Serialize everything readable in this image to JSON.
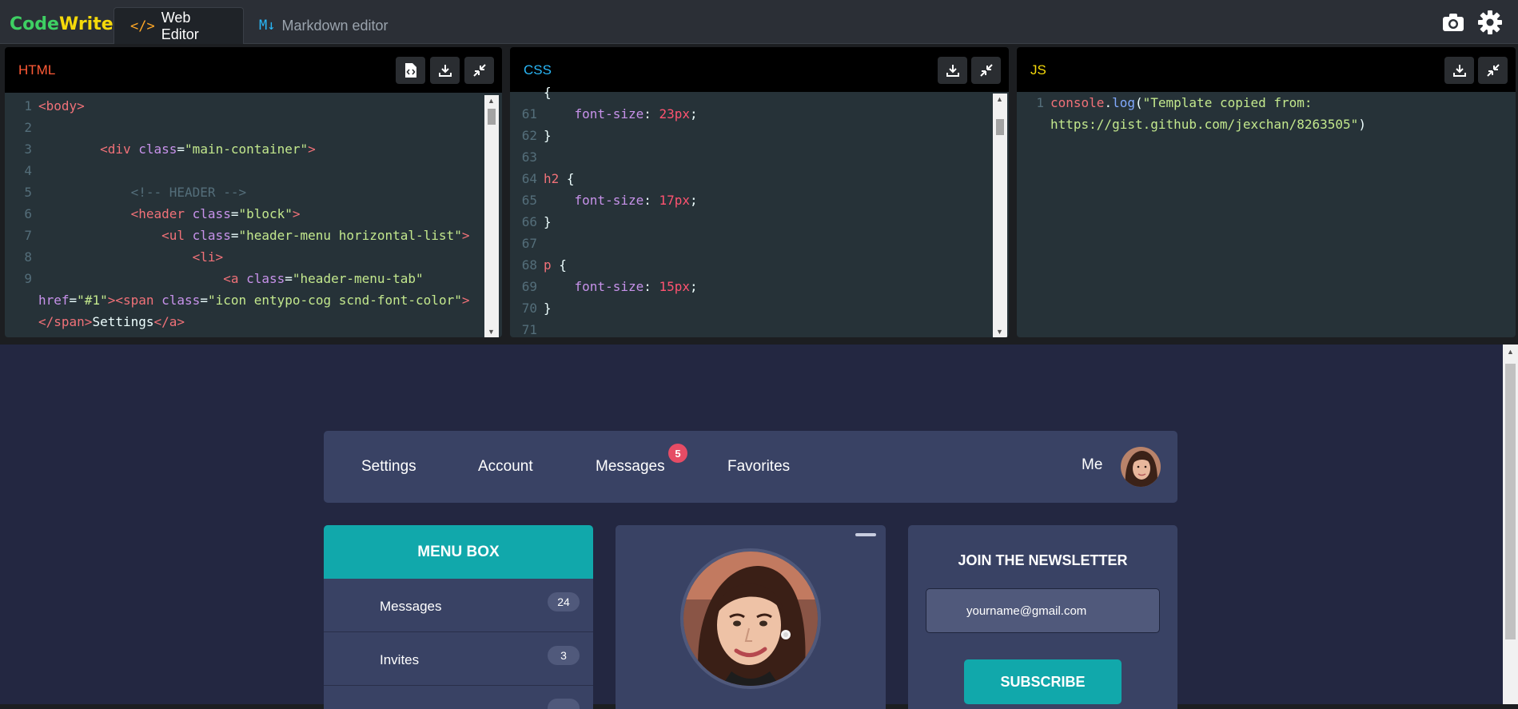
{
  "app": {
    "logo_part1": "Code",
    "logo_part2": "Write",
    "tabs": [
      {
        "icon": "</>",
        "label": "Web Editor",
        "active": true
      },
      {
        "icon": "M↓",
        "label": "Markdown editor",
        "active": false
      }
    ],
    "icons": [
      "camera-icon",
      "gear-icon"
    ]
  },
  "panels": {
    "html": {
      "title": "HTML",
      "color": "#ff5a36"
    },
    "css": {
      "title": "CSS",
      "color": "#29b6f6"
    },
    "js": {
      "title": "JS",
      "color": "#f5d90a"
    }
  },
  "html_code": {
    "lines": [
      {
        "n": "1",
        "indent": "",
        "parts": [
          [
            "tag",
            "<body>"
          ]
        ]
      },
      {
        "n": "2",
        "indent": "",
        "parts": []
      },
      {
        "n": "3",
        "indent": "        ",
        "parts": [
          [
            "tag",
            "<div "
          ],
          [
            "attr",
            "class"
          ],
          [
            "plain",
            "="
          ],
          [
            "str",
            "\"main-container\""
          ],
          [
            "tag",
            ">"
          ]
        ]
      },
      {
        "n": "4",
        "indent": "",
        "parts": []
      },
      {
        "n": "5",
        "indent": "            ",
        "parts": [
          [
            "cmt",
            "<!-- HEADER -->"
          ]
        ]
      },
      {
        "n": "6",
        "indent": "            ",
        "parts": [
          [
            "tag",
            "<header "
          ],
          [
            "attr",
            "class"
          ],
          [
            "plain",
            "="
          ],
          [
            "str",
            "\"block\""
          ],
          [
            "tag",
            ">"
          ]
        ]
      },
      {
        "n": "7",
        "indent": "                ",
        "parts": [
          [
            "tag",
            "<ul "
          ],
          [
            "attr",
            "class"
          ],
          [
            "plain",
            "="
          ],
          [
            "str",
            "\"header-menu horizontal-list\""
          ],
          [
            "tag",
            ">"
          ]
        ]
      },
      {
        "n": "8",
        "indent": "                    ",
        "parts": [
          [
            "tag",
            "<li>"
          ]
        ]
      },
      {
        "n": "9",
        "indent": "                        ",
        "parts": [
          [
            "tag",
            "<a "
          ],
          [
            "attr",
            "class"
          ],
          [
            "plain",
            "="
          ],
          [
            "str",
            "\"header-menu-tab\""
          ]
        ]
      },
      {
        "n": "",
        "indent": "",
        "parts": [
          [
            "attr",
            "href"
          ],
          [
            "plain",
            "="
          ],
          [
            "str",
            "\"#1\""
          ],
          [
            "tag",
            ">"
          ],
          [
            "tag",
            "<span "
          ],
          [
            "attr",
            "class"
          ],
          [
            "plain",
            "="
          ],
          [
            "str",
            "\"icon entypo-cog scnd-font-color\""
          ],
          [
            "tag",
            ">"
          ]
        ]
      },
      {
        "n": "",
        "indent": "",
        "parts": [
          [
            "tag",
            "</span>"
          ],
          [
            "plain",
            "Settings"
          ],
          [
            "tag",
            "</a>"
          ]
        ]
      }
    ]
  },
  "css_code": {
    "lines": [
      {
        "n": "",
        "indent": "",
        "parts": [
          [
            "plain",
            "{"
          ]
        ]
      },
      {
        "n": "61",
        "indent": "    ",
        "parts": [
          [
            "prop",
            "font-size"
          ],
          [
            "plain",
            ": "
          ],
          [
            "unit",
            "23px"
          ],
          [
            "plain",
            ";"
          ]
        ]
      },
      {
        "n": "62",
        "indent": "",
        "parts": [
          [
            "plain",
            "}"
          ]
        ]
      },
      {
        "n": "63",
        "indent": "",
        "parts": []
      },
      {
        "n": "64",
        "indent": "",
        "parts": [
          [
            "tag",
            "h2"
          ],
          [
            "plain",
            " {"
          ]
        ]
      },
      {
        "n": "65",
        "indent": "    ",
        "parts": [
          [
            "prop",
            "font-size"
          ],
          [
            "plain",
            ": "
          ],
          [
            "unit",
            "17px"
          ],
          [
            "plain",
            ";"
          ]
        ]
      },
      {
        "n": "66",
        "indent": "",
        "parts": [
          [
            "plain",
            "}"
          ]
        ]
      },
      {
        "n": "67",
        "indent": "",
        "parts": []
      },
      {
        "n": "68",
        "indent": "",
        "parts": [
          [
            "tag",
            "p"
          ],
          [
            "plain",
            " {"
          ]
        ]
      },
      {
        "n": "69",
        "indent": "    ",
        "parts": [
          [
            "prop",
            "font-size"
          ],
          [
            "plain",
            ": "
          ],
          [
            "unit",
            "15px"
          ],
          [
            "plain",
            ";"
          ]
        ]
      },
      {
        "n": "70",
        "indent": "",
        "parts": [
          [
            "plain",
            "}"
          ]
        ]
      },
      {
        "n": "71",
        "indent": "",
        "parts": []
      }
    ]
  },
  "js_code": {
    "lines": [
      {
        "n": "1",
        "indent": "",
        "parts": [
          [
            "tag",
            "console"
          ],
          [
            "plain",
            "."
          ],
          [
            "fn",
            "log"
          ],
          [
            "plain",
            "("
          ],
          [
            "str",
            "\"Template copied from:"
          ]
        ]
      },
      {
        "n": "",
        "indent": "",
        "parts": [
          [
            "str",
            "https://gist.github.com/jexchan/8263505\""
          ],
          [
            "plain",
            ")"
          ]
        ]
      }
    ]
  },
  "preview": {
    "nav": {
      "items": [
        "Settings",
        "Account",
        "Messages",
        "Favorites"
      ],
      "messages_badge": "5",
      "me_label": "Me"
    },
    "menu_box": {
      "title": "MENU BOX",
      "items": [
        {
          "label": "Messages",
          "count": "24"
        },
        {
          "label": "Invites",
          "count": "3"
        }
      ]
    },
    "newsletter": {
      "title": "JOIN THE NEWSLETTER",
      "input_value": "yourname@gmail.com",
      "button": "SUBSCRIBE"
    }
  },
  "colors": {
    "accent_teal": "#11a8ab",
    "badge_red": "#e64c65",
    "card_bg": "#394264",
    "preview_bg": "#232741"
  }
}
